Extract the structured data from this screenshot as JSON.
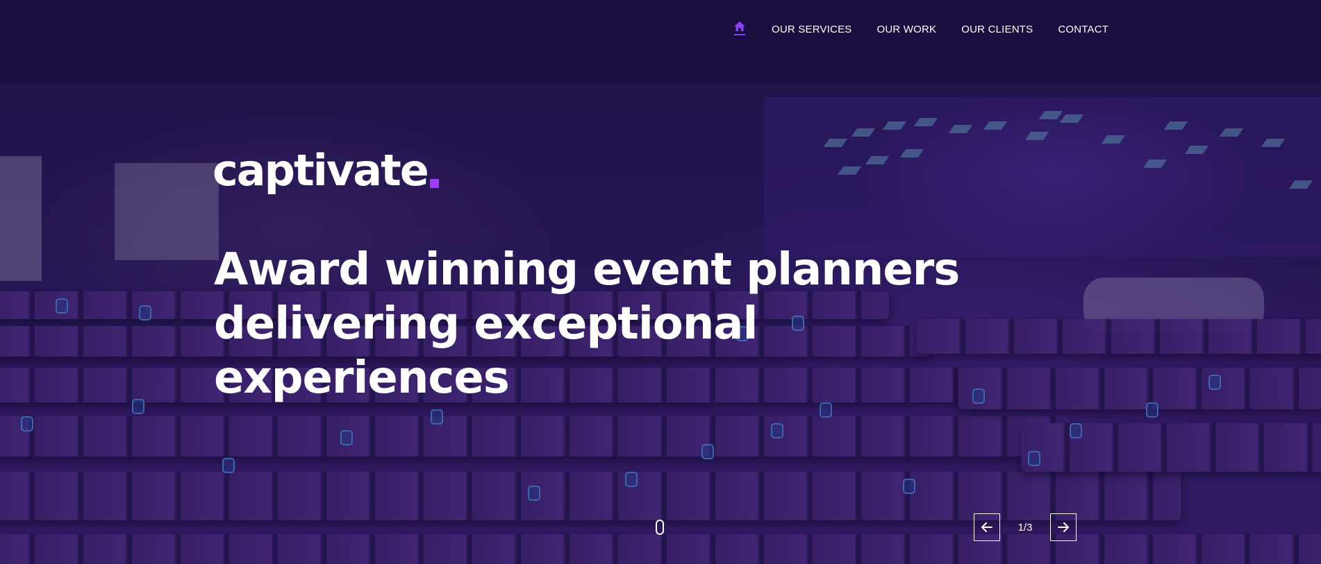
{
  "nav": {
    "home_icon": "home-icon",
    "items": [
      {
        "label": "OUR SERVICES"
      },
      {
        "label": "OUR WORK"
      },
      {
        "label": "OUR CLIENTS"
      },
      {
        "label": "CONTACT"
      }
    ]
  },
  "brand": {
    "logo_text": "captivate",
    "accent_color": "#9b3df5"
  },
  "hero": {
    "headline_line1": "Award winning event planners",
    "headline_line2": "delivering exceptional",
    "headline_line3": "experiences",
    "highlight_colors": [
      "#2b8ed8",
      "#8a3ff5"
    ]
  },
  "slider": {
    "prev_icon": "arrow-left-icon",
    "next_icon": "arrow-right-icon",
    "counter": "1/3"
  },
  "scroll_icon": "mouse-scroll-icon"
}
